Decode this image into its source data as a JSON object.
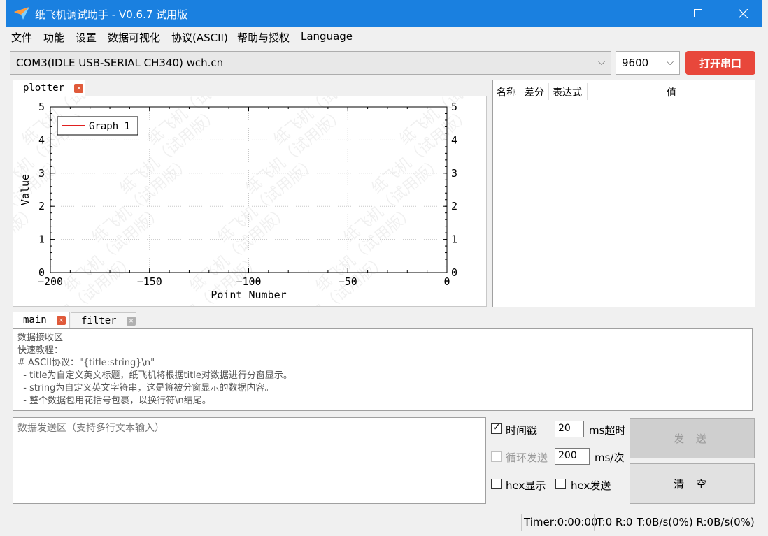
{
  "window": {
    "title": "纸飞机调试助手 - V0.6.7 试用版"
  },
  "menu": [
    "文件",
    "功能",
    "设置",
    "数据可视化",
    "协议(ASCII)",
    "帮助与授权",
    "Language"
  ],
  "port": {
    "selected": "COM3(IDLE  USB-SERIAL CH340) wch.cn",
    "baud": "9600",
    "open_label": "打开串口"
  },
  "plot_tab": {
    "label": "plotter"
  },
  "plot": {
    "legend": "Graph 1",
    "xlabel": "Point Number",
    "ylabel": "Value",
    "x_ticks": [
      "−200",
      "−150",
      "−100",
      "−50",
      "0"
    ],
    "y_ticks": [
      "0",
      "1",
      "2",
      "3",
      "4",
      "5"
    ],
    "xlim": [
      -200,
      0
    ],
    "ylim": [
      0,
      5
    ],
    "series_color": "#e02020",
    "watermark": "纸飞机（试用版）"
  },
  "var_table": {
    "headers": [
      "名称",
      "差分",
      "表达式",
      "值"
    ]
  },
  "text_tabs": [
    {
      "label": "main"
    },
    {
      "label": "filter"
    }
  ],
  "receive": {
    "lines": [
      "数据接收区",
      "",
      "快速教程：",
      "# ASCII协议：\"{title:string}\\n\"",
      "  - title为自定义英文标题，纸飞机将根据title对数据进行分窗显示。",
      "  - string为自定义英文字符串，这是将被分窗显示的数据内容。",
      "  - 整个数据包用花括号包裹，以换行符\\n结尾。"
    ]
  },
  "send": {
    "placeholder": "数据发送区（支持多行文本输入）"
  },
  "options": {
    "timestamp_label": "时间戳",
    "timestamp_checked": true,
    "timeout_value": "20",
    "timeout_unit": "ms超时",
    "loop_label": "循环发送",
    "loop_checked": false,
    "loop_value": "200",
    "loop_unit": "ms/次",
    "hex_display_label": "hex显示",
    "hex_send_label": "hex发送"
  },
  "buttons": {
    "send": "发 送",
    "clear": "清 空"
  },
  "status": {
    "timer": "Timer:0:00:00",
    "counts": "T:0 R:0",
    "rates": "T:0B/s(0%) R:0B/s(0%)"
  },
  "colors": {
    "titlebar": "#1a80e0",
    "open_button": "#e8473b"
  }
}
